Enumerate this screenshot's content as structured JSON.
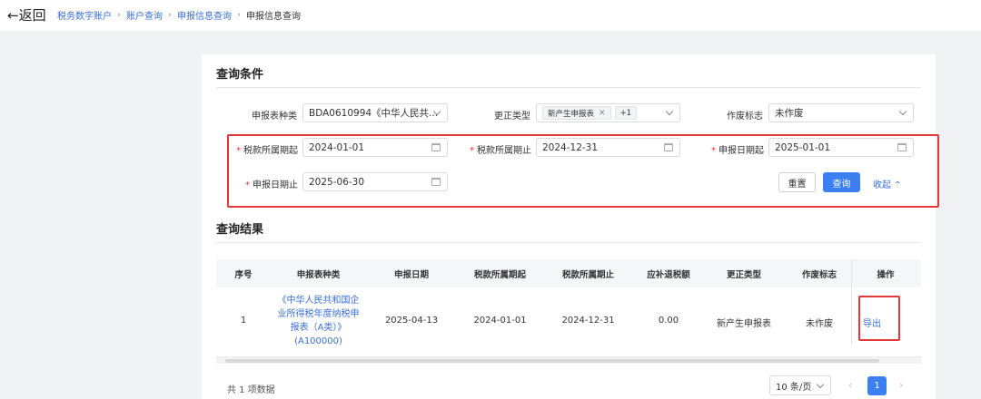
{
  "header": {
    "back_label": "←返回",
    "breadcrumb": [
      "税务数字账户",
      "账户查询",
      "申报信息查询",
      "申报信息查询"
    ]
  },
  "query": {
    "title": "查询条件",
    "report_type": {
      "label": "申报表种类",
      "value": "BDA0610994《中华人民共..."
    },
    "correction_type": {
      "label": "更正类型",
      "tag": "新产生申报表",
      "more": "+1"
    },
    "void_flag": {
      "label": "作废标志",
      "value": "未作废"
    },
    "tax_period_start": {
      "label": "税款所属期起",
      "value": "2024-01-01"
    },
    "tax_period_end": {
      "label": "税款所属期止",
      "value": "2024-12-31"
    },
    "declare_date_start": {
      "label": "申报日期起",
      "value": "2025-01-01"
    },
    "declare_date_end": {
      "label": "申报日期止",
      "value": "2025-06-30"
    },
    "reset_label": "重置",
    "search_label": "查询",
    "collapse_label": "收起 ⌃",
    "required_mark": "*"
  },
  "results": {
    "title": "查询结果",
    "columns": [
      "序号",
      "申报表种类",
      "申报日期",
      "税款所属期起",
      "税款所属期止",
      "应补退税额",
      "更正类型",
      "作废标志",
      "操作"
    ],
    "rows": [
      {
        "index": "1",
        "report_lines": [
          "《中华人民共和国企",
          "业所得税年度纳税申",
          "报表（A类）》",
          "(A100000)"
        ],
        "declare_date": "2025-04-13",
        "period_start": "2024-01-01",
        "period_end": "2024-12-31",
        "tax_due": "0.00",
        "correction_type": "新产生申报表",
        "void_flag": "未作废",
        "action": "导出"
      }
    ]
  },
  "pagination": {
    "total_text": "共 1 项数据",
    "page_size": "10 条/页",
    "current_page": "1"
  },
  "colors": {
    "primary": "#3b7ff0",
    "link": "#3a6fd6",
    "highlight_red": "#e0393b"
  }
}
